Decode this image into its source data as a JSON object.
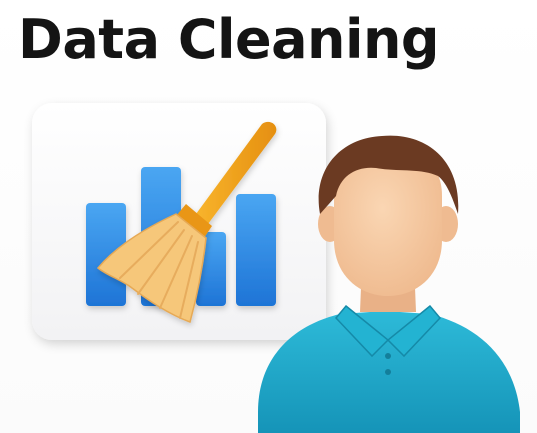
{
  "title": "Data Cleaning",
  "icons": {
    "chart": "bar-chart-icon",
    "broom": "broom-icon",
    "person": "person-avatar-icon"
  },
  "colors": {
    "title": "#141414",
    "bars": "#2f8fe6",
    "broom_handle": "#f1a520",
    "broom_bristles": "#f6c77a",
    "shirt": "#1fa9c9",
    "skin": "#f7cba4",
    "hair": "#6b3a22"
  }
}
